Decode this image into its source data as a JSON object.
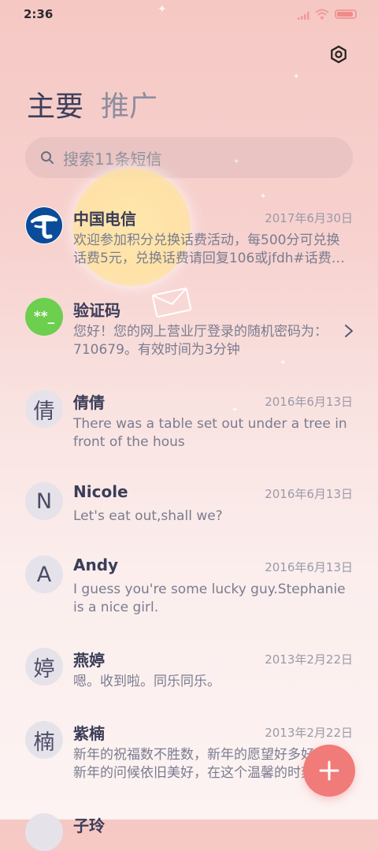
{
  "status_bar": {
    "time": "2:36"
  },
  "header": {
    "tabs": [
      {
        "label": "主要",
        "active": true
      },
      {
        "label": "推广",
        "active": false
      }
    ],
    "settings_icon": "gear-icon"
  },
  "search": {
    "placeholder": "搜索11条短信"
  },
  "messages": [
    {
      "avatar_text": "",
      "avatar_icon": "china-telecom-logo",
      "name": "中国电信",
      "date": "2017年6月30日",
      "preview": "欢迎参加积分兑换话费活动，每500分可兑换话费5元，兑换话费请回复106或jfdh#话费…"
    },
    {
      "avatar_text": "**_",
      "name": "验证码",
      "date": "",
      "preview": "您好！您的网上营业厅登录的随机密码为：710679。有效时间为3分钟"
    },
    {
      "avatar_text": "倩",
      "name": "倩倩",
      "date": "2016年6月13日",
      "preview": "There was a table set out under a tree in front of the hous"
    },
    {
      "avatar_text": "N",
      "name": "Nicole",
      "date": "2016年6月13日",
      "preview": "Let's eat out,shall we?"
    },
    {
      "avatar_text": "A",
      "name": "Andy",
      "date": "2016年6月13日",
      "preview": "I guess you're some lucky guy.Stephanie is a nice girl."
    },
    {
      "avatar_text": "婷",
      "name": "燕婷",
      "date": "2013年2月22日",
      "preview": "嗯。收到啦。同乐同乐。"
    },
    {
      "avatar_text": "楠",
      "name": "紫楠",
      "date": "2013年2月22日",
      "preview": "新年的祝福数不胜数，新年的愿望好多好多，新年的问候依旧美好，在这个温馨的时刻"
    },
    {
      "avatar_text": "",
      "name": "子玲",
      "date": "",
      "preview": ""
    }
  ],
  "fab": {
    "icon": "plus-icon",
    "color": "#f07b78"
  },
  "colors": {
    "telecom_blue": "#0a4c9a",
    "verify_green": "#6ccf4e",
    "accent": "#f07b78"
  }
}
